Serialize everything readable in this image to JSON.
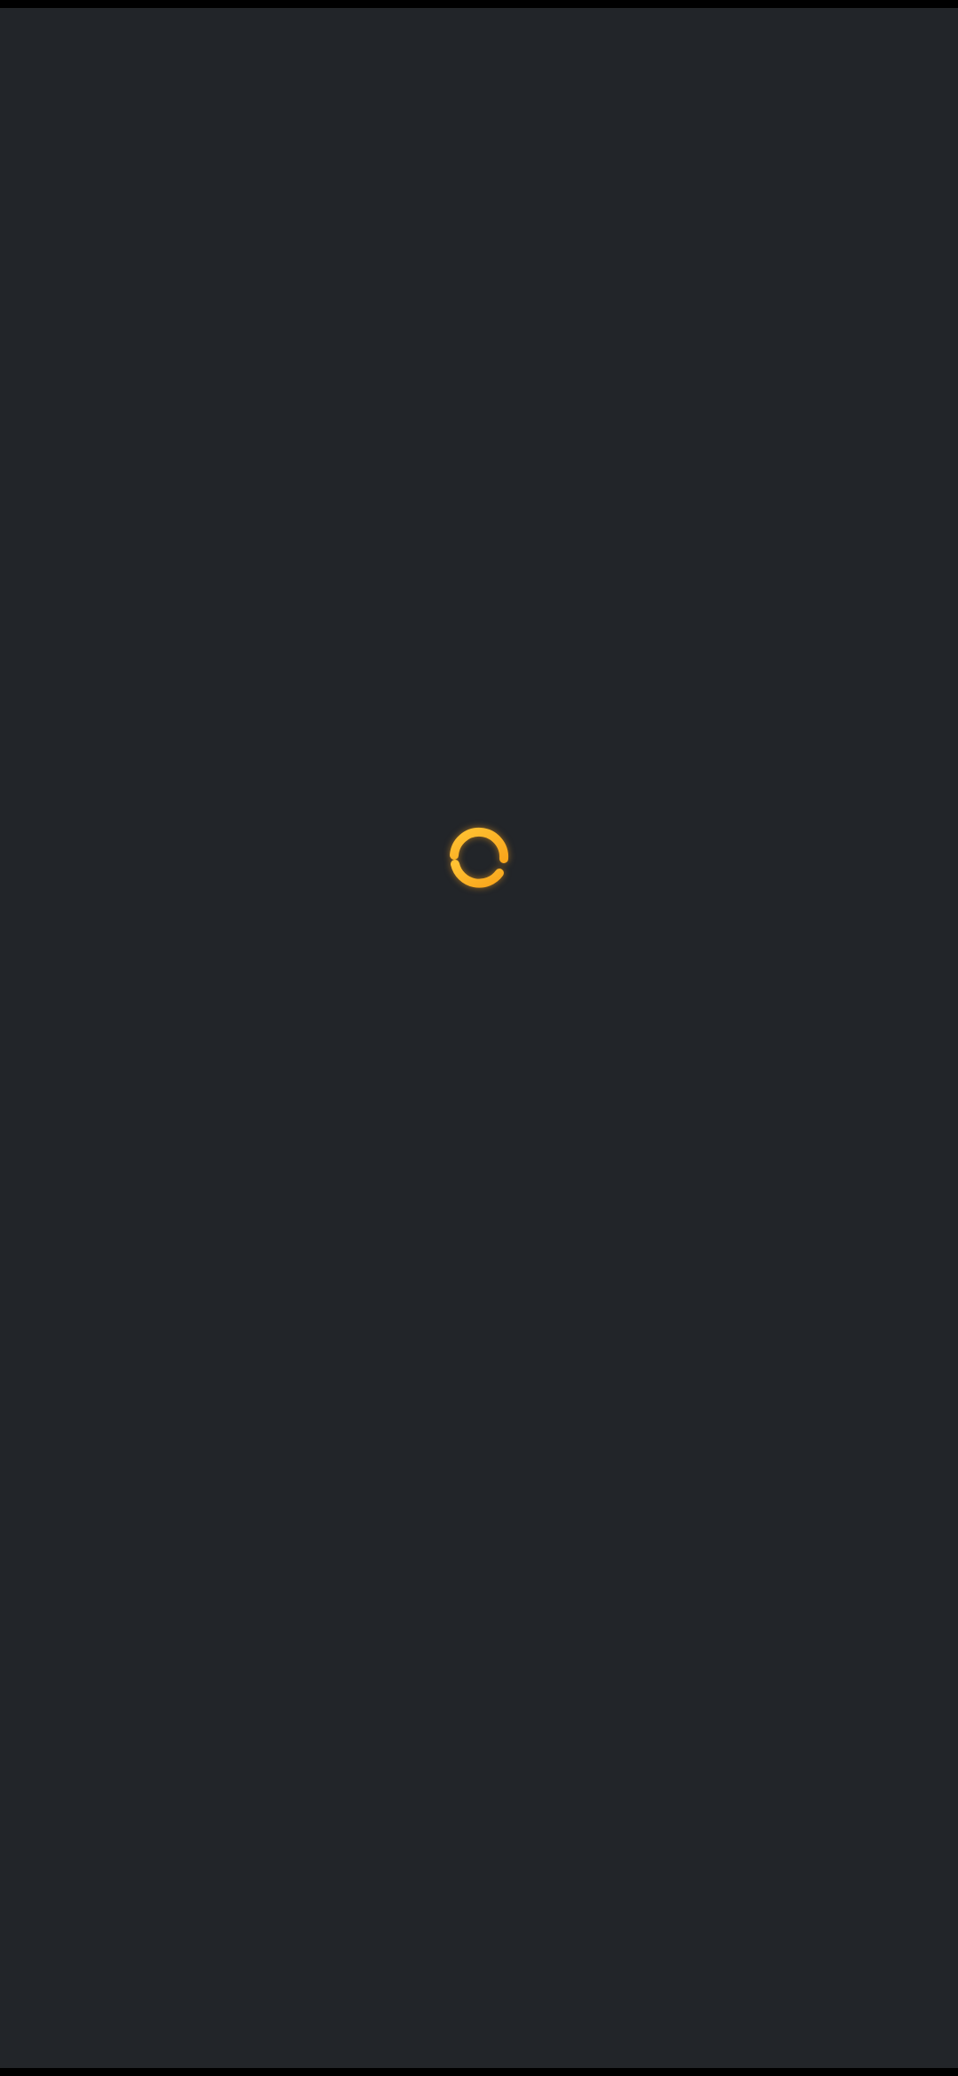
{
  "screen": {
    "state": "loading",
    "background_color": "#222529",
    "spinner": {
      "icon": "loading-spinner-icon",
      "color": "#F9A61C",
      "color_highlight": "#FFC233"
    }
  }
}
